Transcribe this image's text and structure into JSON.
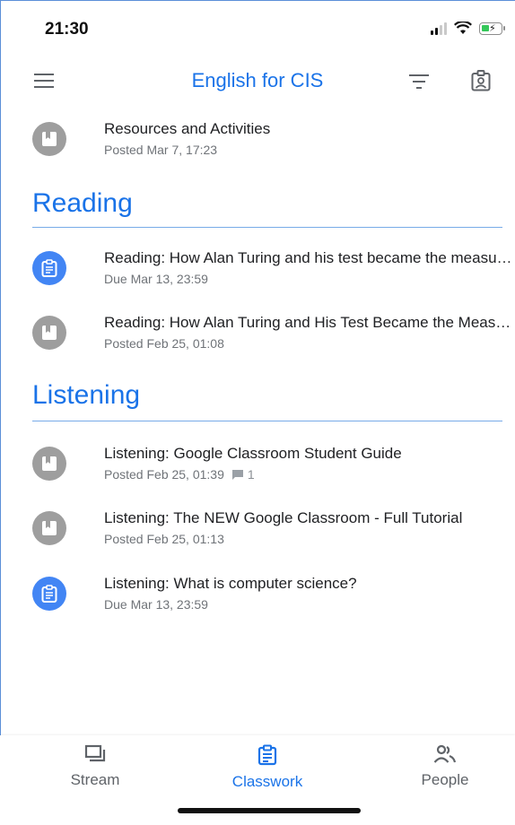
{
  "status_bar": {
    "time": "21:30"
  },
  "app_bar": {
    "title": "English for CIS",
    "icons": [
      "menu-icon",
      "filter-icon",
      "classroom-badge-icon"
    ]
  },
  "top_item": {
    "title": "Resources and Activities",
    "subtitle": "Posted Mar 7, 17:23",
    "icon": "material-icon"
  },
  "sections": [
    {
      "title": "Reading",
      "items": [
        {
          "title": "Reading: How Alan Turing and his test became the measure of AI",
          "subtitle": "Due Mar 13, 23:59",
          "icon": "assignment-icon"
        },
        {
          "title": "Reading: How Alan Turing and His Test Became the Measure of AI",
          "subtitle": "Posted Feb 25, 01:08",
          "icon": "material-icon"
        }
      ]
    },
    {
      "title": "Listening",
      "items": [
        {
          "title": "Listening: Google Classroom Student Guide",
          "subtitle": "Posted Feb 25, 01:39",
          "comments": "1",
          "icon": "material-icon"
        },
        {
          "title": "Listening: The NEW Google Classroom - Full Tutorial",
          "subtitle": "Posted Feb 25, 01:13",
          "icon": "material-icon"
        },
        {
          "title": "Listening: What is computer science?",
          "subtitle": "Due Mar 13, 23:59",
          "icon": "assignment-icon"
        }
      ]
    }
  ],
  "bottom_nav": {
    "items": [
      {
        "label": "Stream",
        "icon": "stream-icon",
        "active": false
      },
      {
        "label": "Classwork",
        "icon": "classwork-icon",
        "active": true
      },
      {
        "label": "People",
        "icon": "people-icon",
        "active": false
      }
    ]
  },
  "colors": {
    "accent": "#1a73e8",
    "assignment": "#4285f4",
    "material": "#9e9e9e"
  }
}
